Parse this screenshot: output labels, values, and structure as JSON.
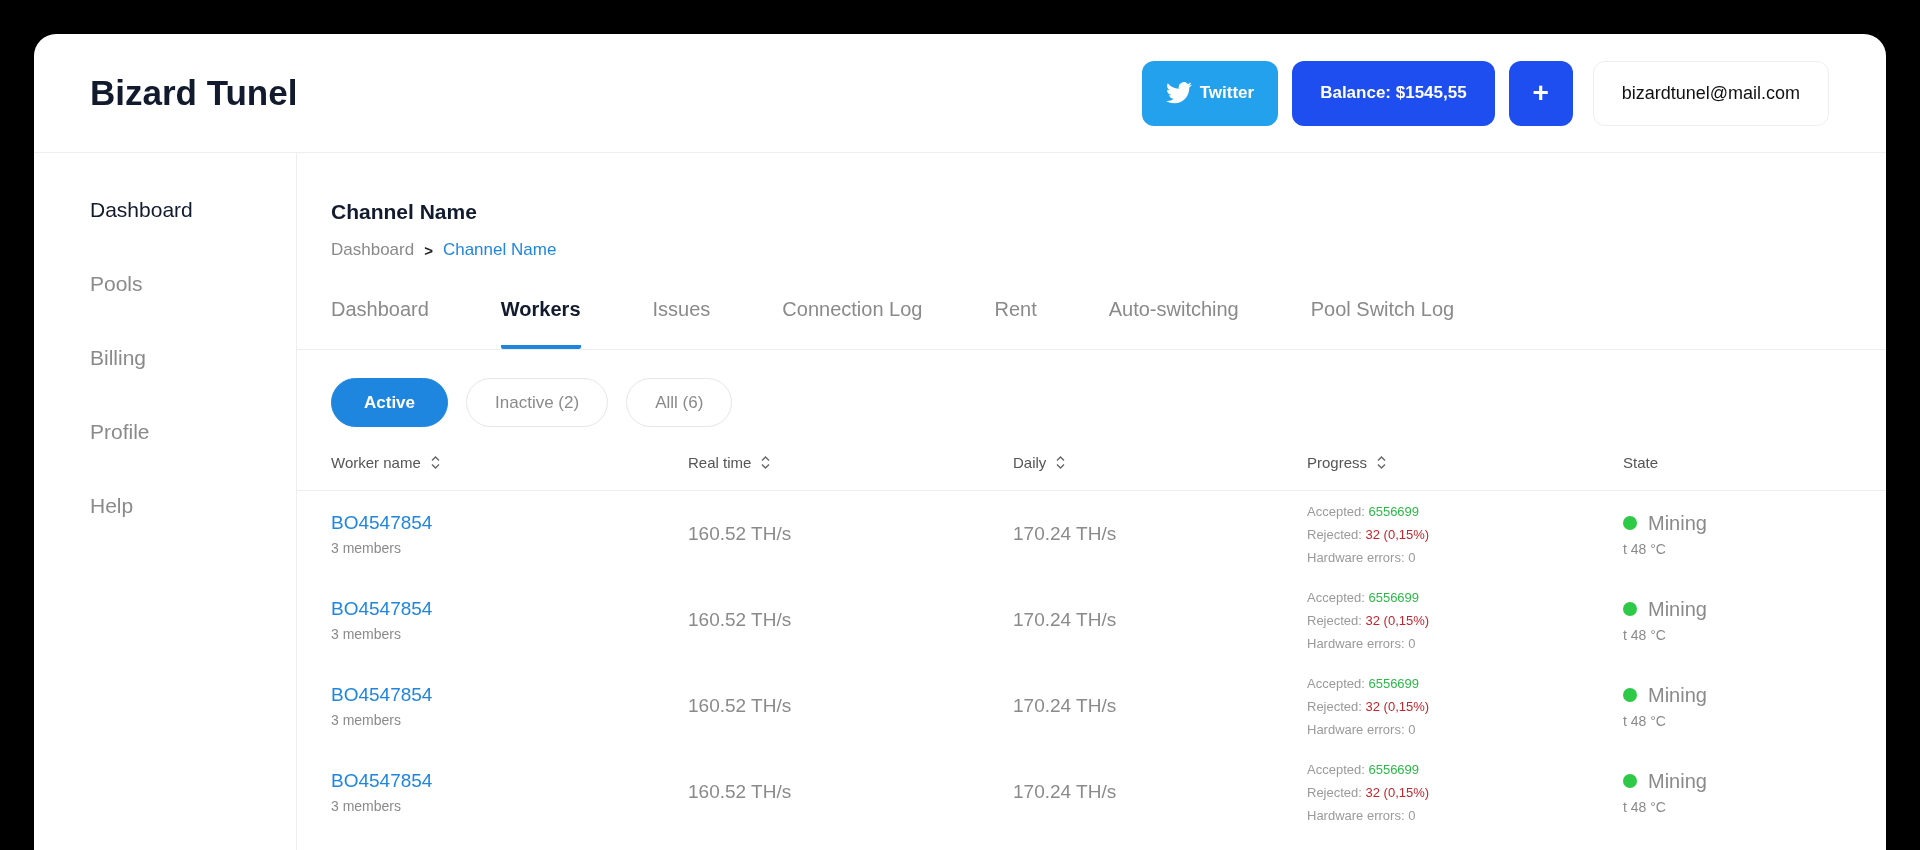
{
  "header": {
    "title": "Bizard Tunel",
    "twitter_button": "Twitter",
    "balance_button": "Balance: $1545,55",
    "add_button": "+",
    "account": "bizardtunel@mail.com"
  },
  "sidebar": {
    "items": [
      {
        "label": "Dashboard",
        "selected": true
      },
      {
        "label": "Pools",
        "selected": false
      },
      {
        "label": "Billing",
        "selected": false
      },
      {
        "label": "Profile",
        "selected": false
      },
      {
        "label": "Help",
        "selected": false
      }
    ]
  },
  "page": {
    "title": "Channel Name",
    "breadcrumb": [
      {
        "label": "Dashboard",
        "current": false
      },
      {
        "label": "Channel Name",
        "current": true
      }
    ],
    "breadcrumb_separator": ">"
  },
  "tabs": [
    {
      "label": "Dashboard",
      "selected": false
    },
    {
      "label": "Workers",
      "selected": true
    },
    {
      "label": "Issues",
      "selected": false
    },
    {
      "label": "Connection Log",
      "selected": false
    },
    {
      "label": "Rent",
      "selected": false
    },
    {
      "label": "Auto-switching",
      "selected": false
    },
    {
      "label": "Pool Switch Log",
      "selected": false
    }
  ],
  "filters": [
    {
      "label": "Active",
      "selected": true
    },
    {
      "label": "Inactive (2)",
      "selected": false
    },
    {
      "label": "Alll (6)",
      "selected": false
    }
  ],
  "table": {
    "columns": [
      {
        "label": "Worker name",
        "sortable": true
      },
      {
        "label": "Real time",
        "sortable": true
      },
      {
        "label": "Daily",
        "sortable": true
      },
      {
        "label": "Progress",
        "sortable": true
      },
      {
        "label": "State",
        "sortable": false
      }
    ],
    "rows": [
      {
        "name": "BO4547854",
        "members": "3 members",
        "real_time": "160.52 TH/s",
        "daily": "170.24 TH/s",
        "accepted_label": "Accepted:",
        "accepted": "6556699",
        "rejected_label": "Rejected:",
        "rejected": "32 (0,15%)",
        "hw_errors": "Hardware errors: 0",
        "state": "Mining",
        "color": "#2ec947",
        "temperature": "t 48 °C"
      },
      {
        "name": "BO4547854",
        "members": "3 members",
        "real_time": "160.52 TH/s",
        "daily": "170.24 TH/s",
        "accepted_label": "Accepted:",
        "accepted": "6556699",
        "rejected_label": "Rejected:",
        "rejected": "32 (0,15%)",
        "hw_errors": "Hardware errors: 0",
        "state": "Mining",
        "color": "#2ec947",
        "temperature": "t 48 °C"
      },
      {
        "name": "BO4547854",
        "members": "3 members",
        "real_time": "160.52 TH/s",
        "daily": "170.24 TH/s",
        "accepted_label": "Accepted:",
        "accepted": "6556699",
        "rejected_label": "Rejected:",
        "rejected": "32 (0,15%)",
        "hw_errors": "Hardware errors: 0",
        "state": "Mining",
        "color": "#2ec947",
        "temperature": "t 48 °C"
      },
      {
        "name": "BO4547854",
        "members": "3 members",
        "real_time": "160.52 TH/s",
        "daily": "170.24 TH/s",
        "accepted_label": "Accepted:",
        "accepted": "6556699",
        "rejected_label": "Rejected:",
        "rejected": "32 (0,15%)",
        "hw_errors": "Hardware errors: 0",
        "state": "Mining",
        "color": "#2ec947",
        "temperature": "t 48 °C"
      }
    ]
  }
}
